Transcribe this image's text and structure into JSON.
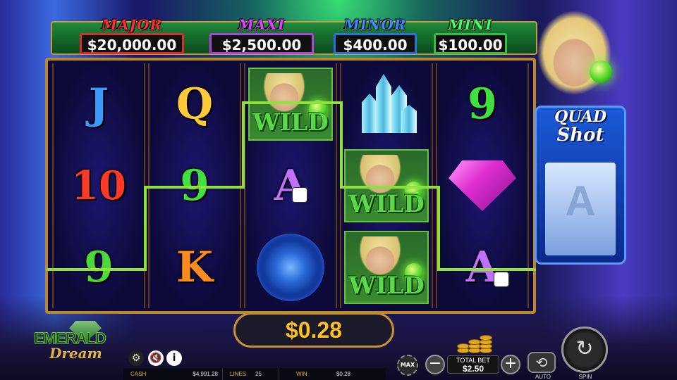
{
  "jackpots": {
    "major": {
      "title": "MAJOR",
      "value": "$20,000.00"
    },
    "maxi": {
      "title": "MAXI",
      "value": "$2,500.00"
    },
    "minor": {
      "title": "MINOR",
      "value": "$400.00"
    },
    "mini": {
      "title": "MINI",
      "value": "$100.00"
    }
  },
  "reels": [
    [
      "J",
      "10",
      "9"
    ],
    [
      "Q",
      "9",
      "K"
    ],
    [
      "WILD",
      "A",
      "blue-rose"
    ],
    [
      "crystal",
      "WILD",
      "WILD"
    ],
    [
      "9",
      "pink-diamond",
      "A"
    ]
  ],
  "wild_label": "WILD",
  "quad_shot": {
    "line1": "QUAD",
    "line2": "Shot"
  },
  "win_amount": "$0.28",
  "logo": {
    "top": "EMERALD",
    "bottom": "Dream"
  },
  "info": {
    "cash_label": "CASH",
    "cash_value": "$4,991.28",
    "lines_label": "LINES",
    "lines_value": "25",
    "win_label": "WIN",
    "win_value": "$0.28"
  },
  "controls": {
    "max_label": "MAX",
    "total_bet_label": "TOTAL BET",
    "total_bet_value": "$2.50",
    "auto_label": "AUTO",
    "spin_label": "SPIN"
  },
  "icons": {
    "settings": "gear-icon",
    "sound": "sound-off-icon",
    "info": "info-icon"
  },
  "colors": {
    "win_line": "#8fe23a",
    "frame": "#b8872e",
    "win_text": "#ffc020"
  }
}
